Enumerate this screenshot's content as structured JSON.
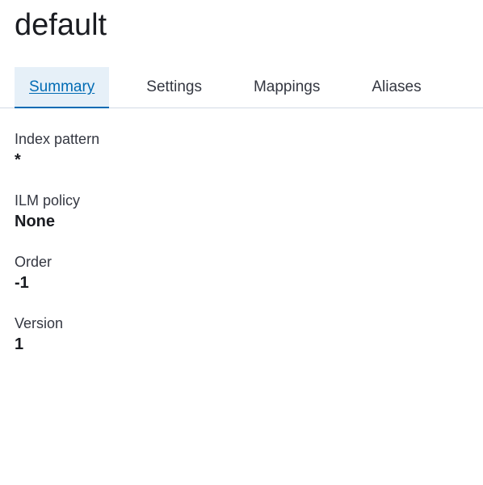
{
  "header": {
    "title": "default"
  },
  "tabs": [
    {
      "label": "Summary",
      "active": true
    },
    {
      "label": "Settings",
      "active": false
    },
    {
      "label": "Mappings",
      "active": false
    },
    {
      "label": "Aliases",
      "active": false
    }
  ],
  "summary": {
    "fields": [
      {
        "label": "Index pattern",
        "value": "*"
      },
      {
        "label": "ILM policy",
        "value": "None"
      },
      {
        "label": "Order",
        "value": "-1"
      },
      {
        "label": "Version",
        "value": "1"
      }
    ]
  }
}
